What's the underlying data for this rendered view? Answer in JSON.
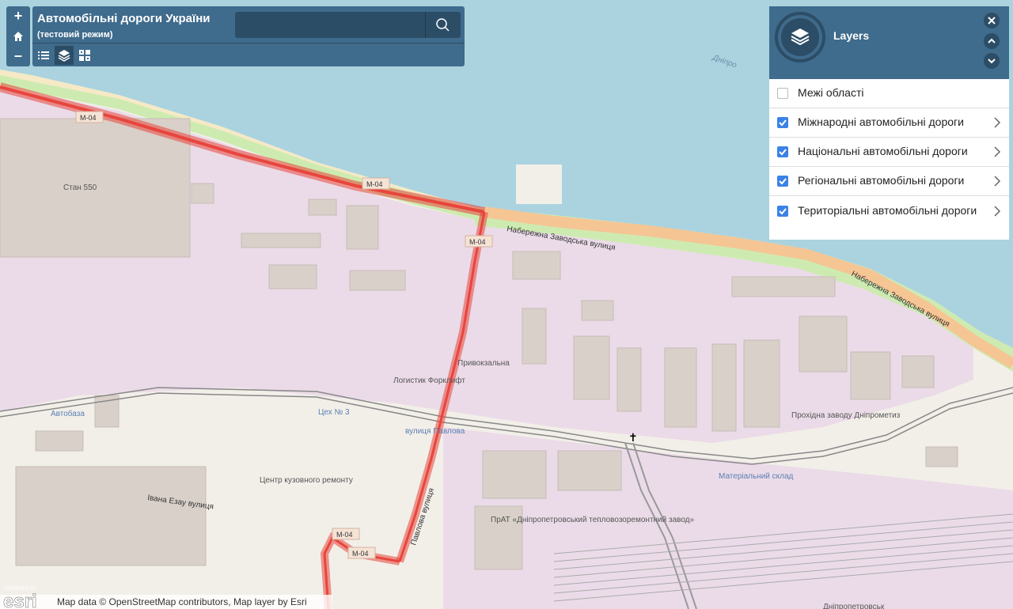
{
  "app": {
    "title": "Автомобільні дороги України",
    "subtitle": "(тестовий режим)"
  },
  "search": {
    "value": "",
    "placeholder": ""
  },
  "zoom": {
    "in_label": "+",
    "out_label": "–"
  },
  "toolbar": {
    "icons": [
      "list-icon",
      "layers-icon",
      "basemap-icon"
    ]
  },
  "layers_panel": {
    "title": "Layers",
    "items": [
      {
        "label": "Межі області",
        "checked": false,
        "expandable": false
      },
      {
        "label": "Міжнародні автомобільні дороги",
        "checked": true,
        "expandable": true
      },
      {
        "label": "Національні автомобільні дороги",
        "checked": true,
        "expandable": true
      },
      {
        "label": "Регіональні автомобільні дороги",
        "checked": true,
        "expandable": true
      },
      {
        "label": "Територіальні автомобільні дороги",
        "checked": true,
        "expandable": true
      }
    ]
  },
  "map_labels": {
    "river": "Дніпро",
    "stan": "Стан 550",
    "m04": "М-04",
    "embankment": "Набережна Заводська вулиця",
    "pryvokzalna": "Привокзальна",
    "logistic": "Логистик Форклифт",
    "avtobaza": "Автобаза",
    "tsekh": "Цех № 3",
    "pavlova_stop": "вулиця Павлова",
    "pavlova_street": "Павлова вулиця",
    "center_kuz": "Центр кузовного ремонту",
    "ezau": "Івана Езау вулиця",
    "prat": "ПрАТ «Дніпропетровський тепловозоремонтний завод»",
    "prokhidna": "Прохідна заводу Дніпрометиз",
    "material": "Матеріальний склад",
    "bottom_right": "Дніпропетровськ"
  },
  "attribution": {
    "esri_powered": "POWERED BY",
    "esri_logo": "esri",
    "text": "Map data © OpenStreetMap contributors, Map layer by Esri"
  },
  "colors": {
    "panel": "#3f6b8c",
    "water": "#aad3df",
    "road_red": "#e8453c",
    "checkbox": "#3b82e6"
  }
}
